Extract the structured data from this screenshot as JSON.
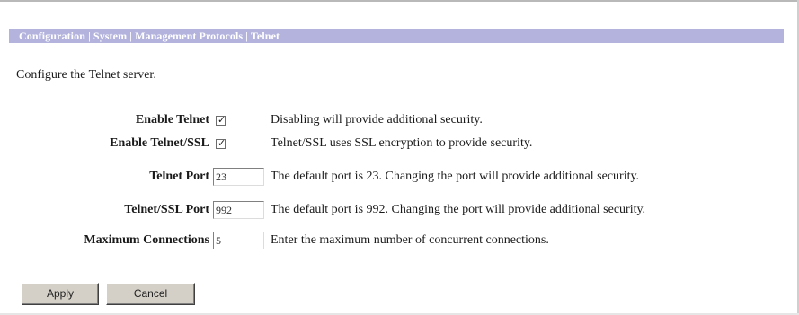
{
  "breadcrumb": "Configuration | System | Management Protocols | Telnet",
  "intro": "Configure the Telnet server.",
  "fields": [
    {
      "label": "Enable Telnet",
      "type": "checkbox",
      "checked": true,
      "description": "Disabling will provide additional security."
    },
    {
      "label": "Enable Telnet/SSL",
      "type": "checkbox",
      "checked": true,
      "description": "Telnet/SSL uses SSL encryption to provide security."
    },
    {
      "label": "Telnet Port",
      "type": "text",
      "value": "23",
      "description": "The default port is 23. Changing the port will provide additional security."
    },
    {
      "label": "Telnet/SSL Port",
      "type": "text",
      "value": "992",
      "description": "The default port is 992. Changing the port will provide additional security."
    },
    {
      "label": "Maximum Connections",
      "type": "text",
      "value": "5",
      "description": "Enter the maximum number of concurrent connections."
    }
  ],
  "buttons": {
    "apply": "Apply",
    "cancel": "Cancel"
  },
  "colors": {
    "titlebar": "#b3b3de",
    "button_face": "#d4d0c8"
  }
}
